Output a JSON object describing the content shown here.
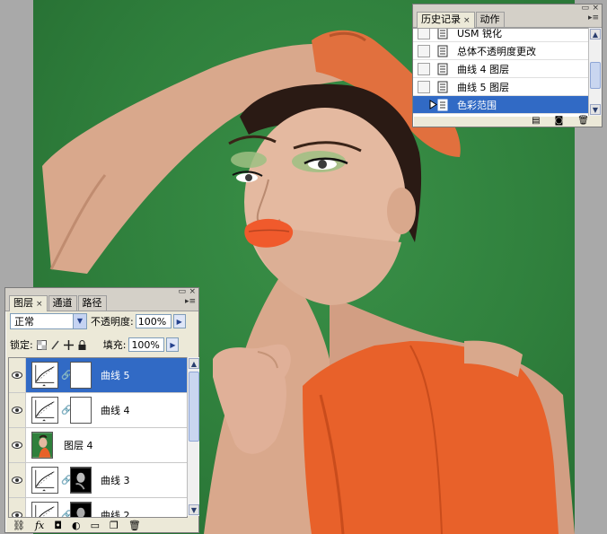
{
  "history_panel": {
    "tabs": [
      {
        "label": "历史记录",
        "active": true
      },
      {
        "label": "动作",
        "active": false
      }
    ],
    "tab_close": "×",
    "items": [
      {
        "label": "USM 锐化",
        "selected": false
      },
      {
        "label": "总体不透明度更改",
        "selected": false
      },
      {
        "label": "曲线 4 图层",
        "selected": false
      },
      {
        "label": "曲线 5 图层",
        "selected": false
      },
      {
        "label": "色彩范围",
        "selected": true
      }
    ],
    "footer_icons": [
      "new-document-icon",
      "snapshot-camera-icon",
      "trash-icon"
    ]
  },
  "layers_panel": {
    "tabs": [
      {
        "label": "图层",
        "active": true
      },
      {
        "label": "通道",
        "active": false
      },
      {
        "label": "路径",
        "active": false
      }
    ],
    "tab_close": "×",
    "blend_mode": "正常",
    "opacity_label": "不透明度:",
    "opacity_value": "100%",
    "lock_label": "锁定:",
    "fill_label": "填充:",
    "fill_value": "100%",
    "layers": [
      {
        "name": "曲线 5",
        "type": "curves",
        "selected": true
      },
      {
        "name": "曲线 4",
        "type": "curves",
        "selected": false
      },
      {
        "name": "图层 4",
        "type": "image",
        "selected": false
      },
      {
        "name": "曲线 3",
        "type": "curves-mask",
        "selected": false
      },
      {
        "name": "曲线 2",
        "type": "curves-mask",
        "selected": false
      }
    ],
    "footer_icons": [
      "link-layers-icon",
      "fx-icon",
      "add-mask-icon",
      "adjustment-layer-icon",
      "new-group-icon",
      "new-layer-icon",
      "delete-layer-icon"
    ]
  },
  "colors": {
    "background_green": "#2f7f3c",
    "selection_blue": "#316ac5",
    "panel_bg": "#ece9d8"
  }
}
